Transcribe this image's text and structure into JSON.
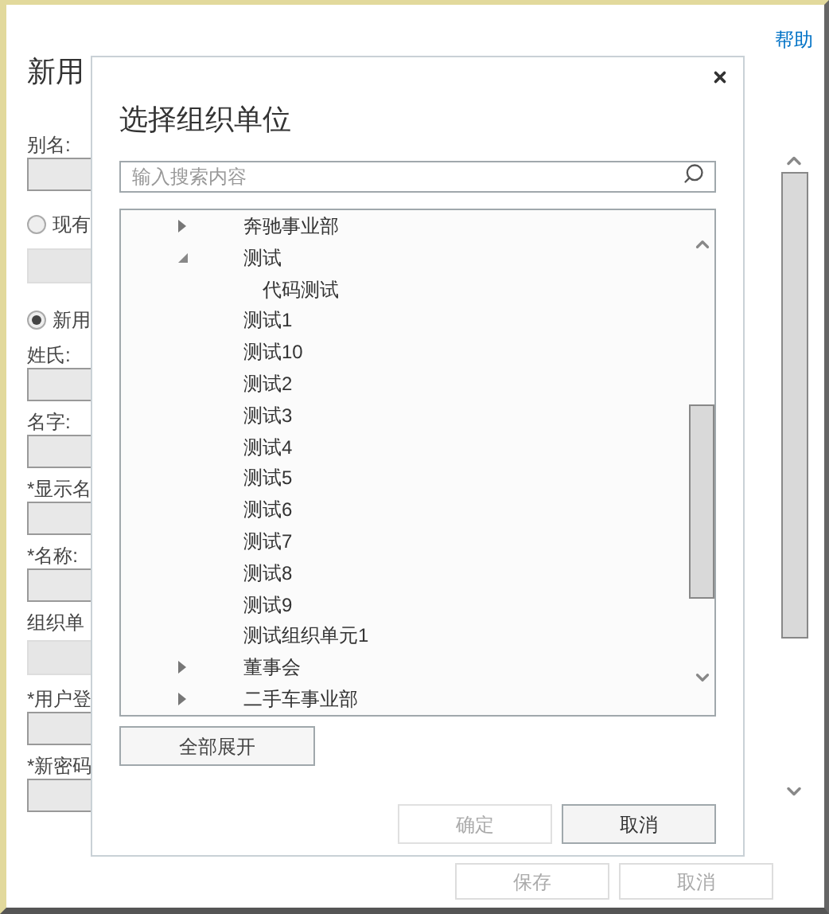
{
  "page": {
    "title": "新用",
    "help_link": "帮助",
    "fields": [
      {
        "kind": "label",
        "text": "别名:"
      },
      {
        "kind": "input"
      },
      {
        "kind": "radio",
        "label": "现有",
        "selected": false
      },
      {
        "kind": "readonly"
      },
      {
        "kind": "radio",
        "label": "新用",
        "selected": true
      },
      {
        "kind": "label",
        "text": "姓氏:"
      },
      {
        "kind": "input"
      },
      {
        "kind": "label",
        "text": "名字:"
      },
      {
        "kind": "input"
      },
      {
        "kind": "label",
        "text": "*显示名"
      },
      {
        "kind": "input"
      },
      {
        "kind": "label",
        "text": "*名称:"
      },
      {
        "kind": "input"
      },
      {
        "kind": "label",
        "text": "组织单"
      },
      {
        "kind": "readonly"
      },
      {
        "kind": "label",
        "text": "*用户登"
      },
      {
        "kind": "input"
      },
      {
        "kind": "label",
        "text": "*新密码"
      },
      {
        "kind": "input"
      }
    ],
    "buttons": [
      {
        "label": "保存",
        "disabled": true
      },
      {
        "label": "取消",
        "disabled": true
      }
    ]
  },
  "dialog": {
    "title": "选择组织单位",
    "search": {
      "placeholder": "输入搜索内容"
    },
    "tree": [
      {
        "label": "奔驰事业部",
        "expanded": false
      },
      {
        "label": "测试",
        "expanded": true,
        "children": [
          {
            "label": "代码测试"
          }
        ]
      },
      {
        "label": "测试1"
      },
      {
        "label": "测试10"
      },
      {
        "label": "测试2"
      },
      {
        "label": "测试3"
      },
      {
        "label": "测试4"
      },
      {
        "label": "测试5"
      },
      {
        "label": "测试6"
      },
      {
        "label": "测试7"
      },
      {
        "label": "测试8"
      },
      {
        "label": "测试9"
      },
      {
        "label": "测试组织单元1"
      },
      {
        "label": "董事会",
        "expanded": false
      },
      {
        "label": "二手车事业部",
        "expanded": false
      }
    ],
    "expand_all": "全部展开",
    "buttons": [
      {
        "label": "确定",
        "disabled": true
      },
      {
        "label": "取消",
        "disabled": false
      }
    ]
  }
}
